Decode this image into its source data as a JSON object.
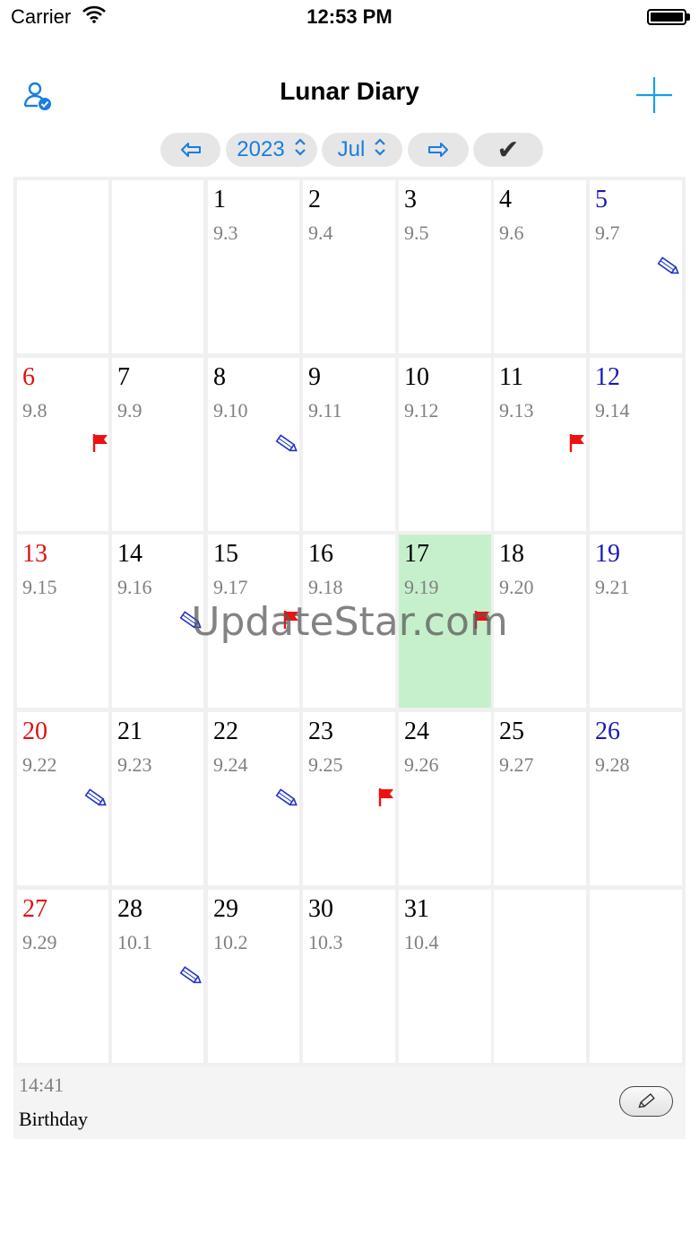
{
  "status_bar": {
    "carrier": "Carrier",
    "time": "12:53 PM"
  },
  "nav": {
    "title": "Lunar Diary"
  },
  "toolbar": {
    "year": "2023",
    "month": "Jul"
  },
  "colors": {
    "sunday": "#e01010",
    "saturday": "#1a1ab8",
    "weekday": "#000000",
    "lunar": "#808080",
    "today_bg": "#c6f0cc",
    "accent": "#1a7de0",
    "flag": "#ee1111",
    "pencil": "#2233cc"
  },
  "calendar": {
    "weeks": [
      [
        null,
        null,
        {
          "day": "1",
          "lunar": "9.3"
        },
        {
          "day": "2",
          "lunar": "9.4"
        },
        {
          "day": "3",
          "lunar": "9.5"
        },
        {
          "day": "4",
          "lunar": "9.6"
        },
        {
          "day": "5",
          "lunar": "9.7",
          "mark": "pencil"
        }
      ],
      [
        {
          "day": "6",
          "lunar": "9.8",
          "mark": "flag"
        },
        {
          "day": "7",
          "lunar": "9.9"
        },
        {
          "day": "8",
          "lunar": "9.10",
          "mark": "pencil"
        },
        {
          "day": "9",
          "lunar": "9.11"
        },
        {
          "day": "10",
          "lunar": "9.12"
        },
        {
          "day": "11",
          "lunar": "9.13",
          "mark": "flag"
        },
        {
          "day": "12",
          "lunar": "9.14"
        }
      ],
      [
        {
          "day": "13",
          "lunar": "9.15"
        },
        {
          "day": "14",
          "lunar": "9.16",
          "mark": "pencil"
        },
        {
          "day": "15",
          "lunar": "9.17",
          "mark": "flag"
        },
        {
          "day": "16",
          "lunar": "9.18"
        },
        {
          "day": "17",
          "lunar": "9.19",
          "mark": "flag",
          "today": true
        },
        {
          "day": "18",
          "lunar": "9.20"
        },
        {
          "day": "19",
          "lunar": "9.21"
        }
      ],
      [
        {
          "day": "20",
          "lunar": "9.22",
          "mark": "pencil"
        },
        {
          "day": "21",
          "lunar": "9.23"
        },
        {
          "day": "22",
          "lunar": "9.24",
          "mark": "pencil"
        },
        {
          "day": "23",
          "lunar": "9.25",
          "mark": "flag"
        },
        {
          "day": "24",
          "lunar": "9.26"
        },
        {
          "day": "25",
          "lunar": "9.27"
        },
        {
          "day": "26",
          "lunar": "9.28"
        }
      ],
      [
        {
          "day": "27",
          "lunar": "9.29"
        },
        {
          "day": "28",
          "lunar": "10.1",
          "mark": "pencil"
        },
        {
          "day": "29",
          "lunar": "10.2"
        },
        {
          "day": "30",
          "lunar": "10.3"
        },
        {
          "day": "31",
          "lunar": "10.4"
        },
        null,
        null
      ]
    ]
  },
  "detail": {
    "time": "14:41",
    "title": "Birthday"
  },
  "watermark": "UpdateStar.com"
}
